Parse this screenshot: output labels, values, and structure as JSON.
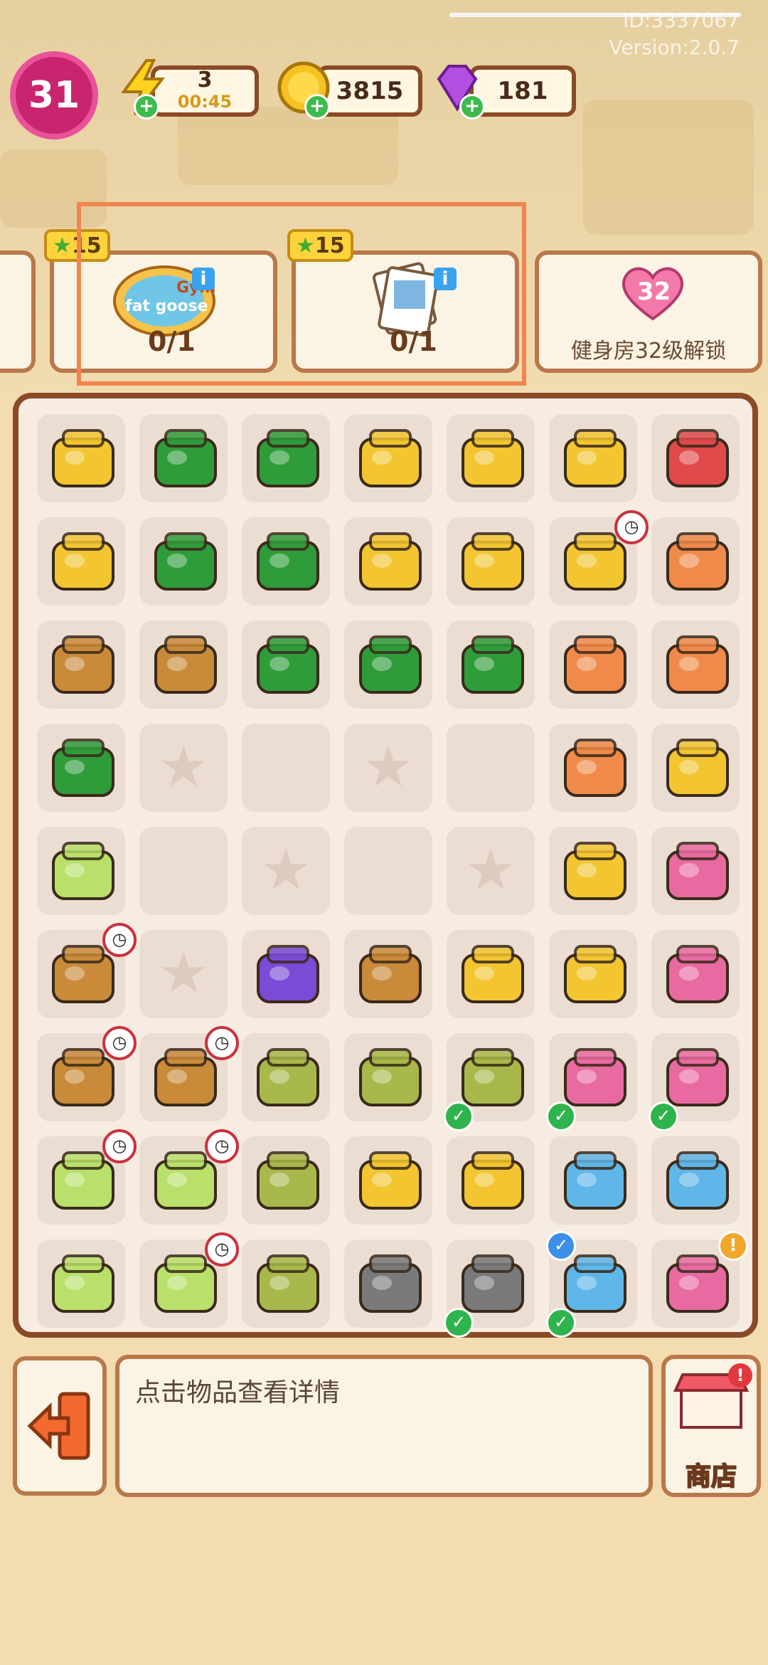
{
  "header": {
    "id_label": "ID:3337067",
    "version_label": "Version:2.0.7"
  },
  "status": {
    "level": "31",
    "energy": "3",
    "energy_timer": "00:45",
    "coins": "3815",
    "gems": "181"
  },
  "cards": [
    {
      "stars": "15",
      "progress": "0/1",
      "art_text_gym": "Gym",
      "art_text_name": "fat goose"
    },
    {
      "stars": "15",
      "progress": "0/1"
    }
  ],
  "locked_card": {
    "level": "32",
    "label": "健身房32级解锁"
  },
  "detail": {
    "hint": "点击物品查看详情"
  },
  "shop": {
    "label": "商店"
  },
  "colors": {
    "accent_pink": "#c9256f",
    "frame_brown": "#8a4a25",
    "highlight_orange": "#f0854f",
    "check_green": "#2fb44d"
  },
  "inventory_icons": [
    [
      "dumbbell-cart-icon",
      "green-toolbox-icon",
      "green-toolbox-icon",
      "duck-shopping-cart-icon",
      "plant-bucket-icon",
      "yellow-bucket-icon",
      "wheelbarrow-icon"
    ],
    [
      "weights-cart-icon",
      "green-toolbox-icon",
      "green-toolbox-icon",
      "yellow-basket-icon",
      "shopping-cart-icon",
      "red-tool-basket-icon",
      "hammer-icon"
    ],
    [
      "dumbbell-box-icon",
      "jump-rope-box-icon",
      "pliers-icon",
      "wrench-icon",
      "screwdriver-icon",
      "utility-knife-icon",
      "tape-measure-icon"
    ],
    [
      "small-toolbox-icon",
      "empty-star-slot",
      "empty-slot",
      "empty-star-slot",
      "empty-slot",
      "pencil-icon",
      "coin-stack-icon"
    ],
    [
      "work-glove-icon",
      "empty-slot",
      "empty-star-slot",
      "empty-slot",
      "empty-star-slot",
      "gold-coin-icon",
      "pink-bricks-icon"
    ],
    [
      "cabinet-icon",
      "empty-star-slot",
      "resistance-band-icon",
      "boxing-glove-icon",
      "coin-pile-icon",
      "coin-tower-icon",
      "brick-pile-icon"
    ],
    [
      "drawer-cabinet-icon",
      "small-cabinet-icon",
      "seed-bag-icon",
      "potted-plant-icon",
      "seed-sack-icon",
      "brick-pallet-icon",
      "brick-pallet-icon"
    ],
    [
      "laptop-icon",
      "laptop-icon",
      "seed-bag-icon",
      "paint-bucket-icon",
      "paint-bucket-icon",
      "robot-vacuum-icon",
      "printer-icon"
    ],
    [
      "laptop-icon",
      "laptop-icon",
      "seed-sack-stack-icon",
      "paint-tub-icon",
      "gym-gear-pile-icon",
      "jump-rope-icon",
      "pink-backpack-icon"
    ]
  ]
}
